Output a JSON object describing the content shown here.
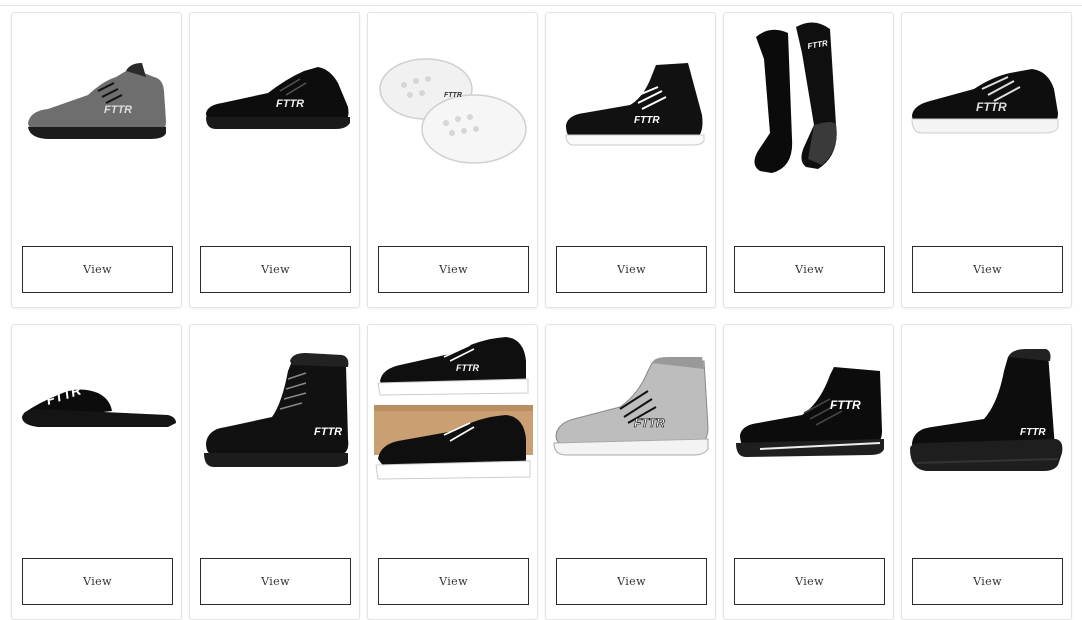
{
  "products": [
    {
      "icon": "gray-sneaker-icon",
      "logo": "FTTR",
      "button_label": "View"
    },
    {
      "icon": "black-low-top-sneaker-icon",
      "logo": "FTTR",
      "button_label": "View"
    },
    {
      "icon": "white-clogs-icon",
      "logo": "FTTR",
      "button_label": "View"
    },
    {
      "icon": "black-high-top-sneaker-icon",
      "logo": "FTTR",
      "button_label": "View"
    },
    {
      "icon": "black-socks-icon",
      "logo": "FTTR",
      "button_label": "View"
    },
    {
      "icon": "black-running-shoe-icon",
      "logo": "FTTR",
      "button_label": "View"
    },
    {
      "icon": "black-slide-sandal-icon",
      "logo": "FTTR",
      "button_label": "View"
    },
    {
      "icon": "black-leather-boot-icon",
      "logo": "FTTR",
      "button_label": "View"
    },
    {
      "icon": "black-white-sneakers-box-icon",
      "logo": "FTTR",
      "button_label": "View"
    },
    {
      "icon": "silver-high-top-sneaker-icon",
      "logo": "FTTR",
      "button_label": "View"
    },
    {
      "icon": "black-canvas-high-top-icon",
      "logo": "FTTR",
      "button_label": "View"
    },
    {
      "icon": "black-platform-boot-icon",
      "logo": "FTTR",
      "button_label": "View"
    }
  ]
}
